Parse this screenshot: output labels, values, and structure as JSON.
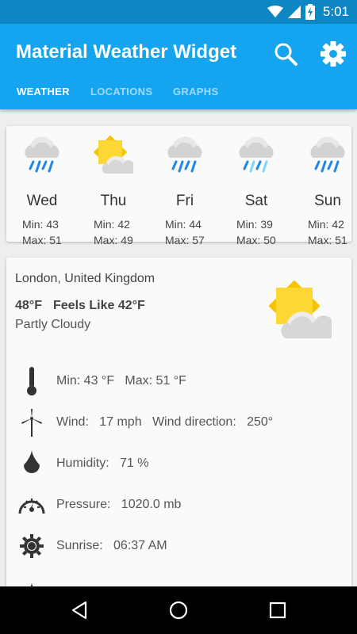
{
  "status_bar": {
    "time": "5:01"
  },
  "app": {
    "title": "Material Weather Widget",
    "tabs": [
      {
        "label": "WEATHER",
        "active": true
      },
      {
        "label": "LOCATIONS",
        "active": false
      },
      {
        "label": "GRAPHS",
        "active": false
      }
    ]
  },
  "forecast": [
    {
      "day": "Wed",
      "icon": "rain",
      "min": "Min: 43",
      "max": "Max: 51"
    },
    {
      "day": "Thu",
      "icon": "partly-cloudy",
      "min": "Min: 42",
      "max": "Max: 49"
    },
    {
      "day": "Fri",
      "icon": "rain",
      "min": "Min: 44",
      "max": "Max: 57"
    },
    {
      "day": "Sat",
      "icon": "sleet",
      "min": "Min: 39",
      "max": "Max: 50"
    },
    {
      "day": "Sun",
      "icon": "rain",
      "min": "Min: 42",
      "max": "Max: 51"
    }
  ],
  "current": {
    "location": "London, United Kingdom",
    "temperature": "48°F",
    "feels_like": "Feels Like 42°F",
    "condition": "Partly Cloudy",
    "icon": "partly-cloudy"
  },
  "details": [
    {
      "icon": "thermometer-icon",
      "text": "Min: 43 °F   Max: 51 °F"
    },
    {
      "icon": "wind-turbine-icon",
      "text": "Wind:   17 mph   Wind direction:   250°"
    },
    {
      "icon": "humidity-drop-icon",
      "text": "Humidity:   71 %"
    },
    {
      "icon": "pressure-gauge-icon",
      "text": "Pressure:   1020.0 mb"
    },
    {
      "icon": "sunrise-icon",
      "text": "Sunrise:   06:37 AM"
    }
  ],
  "colors": {
    "appbar": "#15a4f0",
    "status_bar": "#0d87c4",
    "sun": "#fdd835",
    "cloud": "#d7d7d7",
    "rain": "#1e88e5"
  }
}
